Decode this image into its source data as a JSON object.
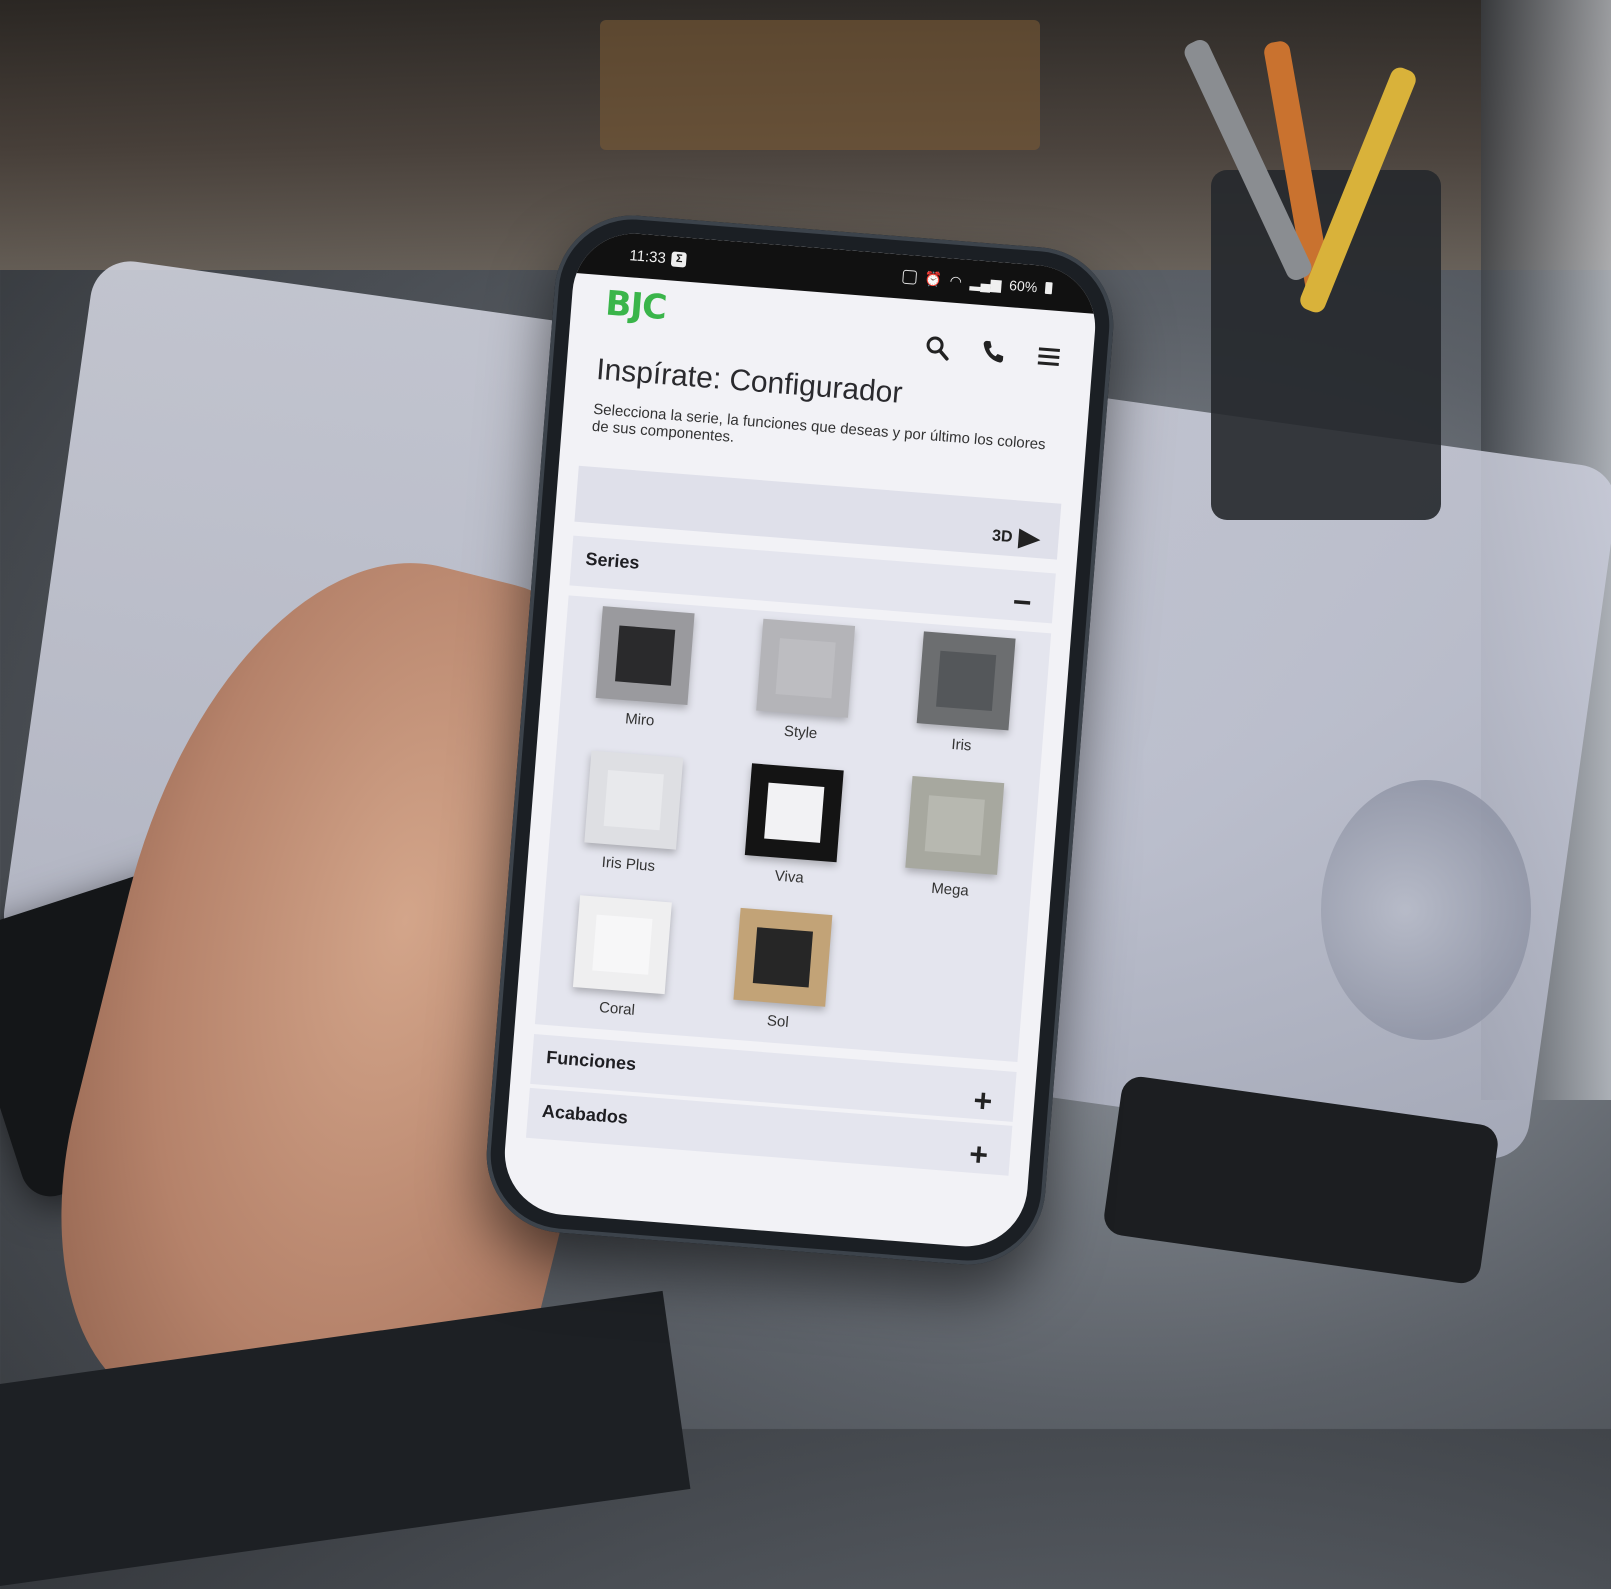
{
  "statusbar": {
    "time": "11:33",
    "time_badge": "Σ",
    "battery": "60%"
  },
  "header": {
    "logo": "BJC",
    "icons": [
      "search-icon",
      "phone-icon",
      "menu-icon"
    ],
    "brand_color": "#3ab54a"
  },
  "page": {
    "title": "Inspírate: Configurador",
    "description": "Selecciona la serie, la funciones que deseas y por último los colores de sus componentes."
  },
  "viewer": {
    "button_3d": "3D"
  },
  "sections": {
    "series": {
      "label": "Series",
      "toggle": "−",
      "items": [
        {
          "label": "Miro",
          "frame": "#9a9a9e",
          "inner": "#2a2a2c"
        },
        {
          "label": "Style",
          "frame": "#b4b4b8",
          "inner": "#bdbdc1"
        },
        {
          "label": "Iris",
          "frame": "#6c6e70",
          "inner": "#54575a"
        },
        {
          "label": "Iris Plus",
          "frame": "#dedfe3",
          "inner": "#e8e9ec"
        },
        {
          "label": "Viva",
          "frame": "#141414",
          "inner": "#f2f2f4"
        },
        {
          "label": "Mega",
          "frame": "#a7a89f",
          "inner": "#b7b8b0"
        },
        {
          "label": "Coral",
          "frame": "#efeff0",
          "inner": "#f7f7f8"
        },
        {
          "label": "Sol",
          "frame": "#c2a377",
          "inner": "#262626"
        }
      ]
    },
    "funciones": {
      "label": "Funciones",
      "toggle": "+"
    },
    "acabados": {
      "label": "Acabados",
      "toggle": "+"
    }
  }
}
